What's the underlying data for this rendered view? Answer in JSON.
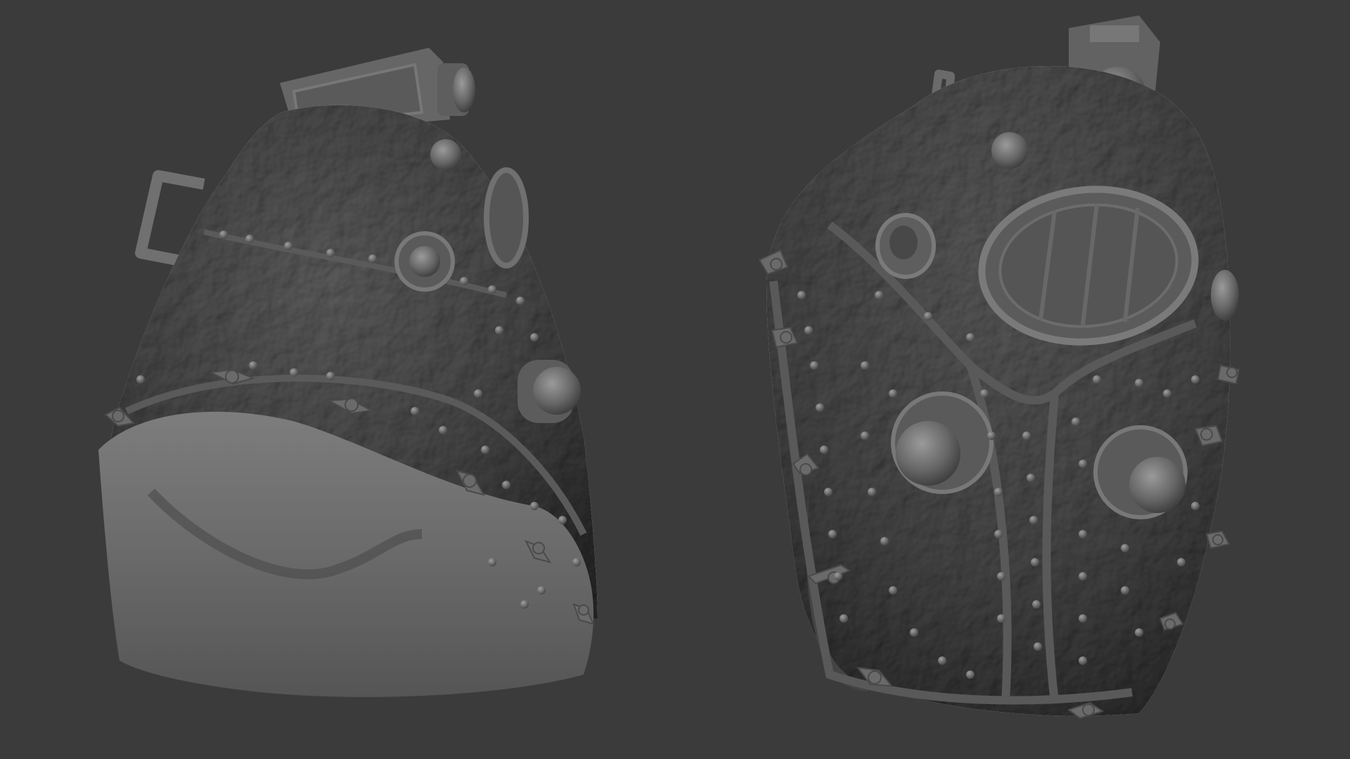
{
  "scene": {
    "background_color": "#3b3b3b",
    "material_color": "#6e6e6e",
    "models": [
      {
        "id": "helmet-side-view",
        "icon": "diving-helmet-sculpt"
      },
      {
        "id": "helmet-three-quarter-view",
        "icon": "diving-helmet-sculpt"
      }
    ]
  }
}
